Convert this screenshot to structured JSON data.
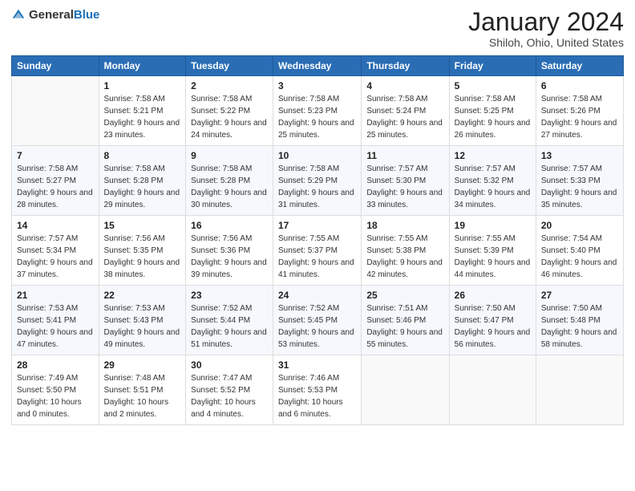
{
  "header": {
    "logo_general": "General",
    "logo_blue": "Blue",
    "title": "January 2024",
    "subtitle": "Shiloh, Ohio, United States"
  },
  "days_of_week": [
    "Sunday",
    "Monday",
    "Tuesday",
    "Wednesday",
    "Thursday",
    "Friday",
    "Saturday"
  ],
  "weeks": [
    [
      {
        "day": "",
        "sunrise": "",
        "sunset": "",
        "daylight": ""
      },
      {
        "day": "1",
        "sunrise": "Sunrise: 7:58 AM",
        "sunset": "Sunset: 5:21 PM",
        "daylight": "Daylight: 9 hours and 23 minutes."
      },
      {
        "day": "2",
        "sunrise": "Sunrise: 7:58 AM",
        "sunset": "Sunset: 5:22 PM",
        "daylight": "Daylight: 9 hours and 24 minutes."
      },
      {
        "day": "3",
        "sunrise": "Sunrise: 7:58 AM",
        "sunset": "Sunset: 5:23 PM",
        "daylight": "Daylight: 9 hours and 25 minutes."
      },
      {
        "day": "4",
        "sunrise": "Sunrise: 7:58 AM",
        "sunset": "Sunset: 5:24 PM",
        "daylight": "Daylight: 9 hours and 25 minutes."
      },
      {
        "day": "5",
        "sunrise": "Sunrise: 7:58 AM",
        "sunset": "Sunset: 5:25 PM",
        "daylight": "Daylight: 9 hours and 26 minutes."
      },
      {
        "day": "6",
        "sunrise": "Sunrise: 7:58 AM",
        "sunset": "Sunset: 5:26 PM",
        "daylight": "Daylight: 9 hours and 27 minutes."
      }
    ],
    [
      {
        "day": "7",
        "sunrise": "Sunrise: 7:58 AM",
        "sunset": "Sunset: 5:27 PM",
        "daylight": "Daylight: 9 hours and 28 minutes."
      },
      {
        "day": "8",
        "sunrise": "Sunrise: 7:58 AM",
        "sunset": "Sunset: 5:28 PM",
        "daylight": "Daylight: 9 hours and 29 minutes."
      },
      {
        "day": "9",
        "sunrise": "Sunrise: 7:58 AM",
        "sunset": "Sunset: 5:28 PM",
        "daylight": "Daylight: 9 hours and 30 minutes."
      },
      {
        "day": "10",
        "sunrise": "Sunrise: 7:58 AM",
        "sunset": "Sunset: 5:29 PM",
        "daylight": "Daylight: 9 hours and 31 minutes."
      },
      {
        "day": "11",
        "sunrise": "Sunrise: 7:57 AM",
        "sunset": "Sunset: 5:30 PM",
        "daylight": "Daylight: 9 hours and 33 minutes."
      },
      {
        "day": "12",
        "sunrise": "Sunrise: 7:57 AM",
        "sunset": "Sunset: 5:32 PM",
        "daylight": "Daylight: 9 hours and 34 minutes."
      },
      {
        "day": "13",
        "sunrise": "Sunrise: 7:57 AM",
        "sunset": "Sunset: 5:33 PM",
        "daylight": "Daylight: 9 hours and 35 minutes."
      }
    ],
    [
      {
        "day": "14",
        "sunrise": "Sunrise: 7:57 AM",
        "sunset": "Sunset: 5:34 PM",
        "daylight": "Daylight: 9 hours and 37 minutes."
      },
      {
        "day": "15",
        "sunrise": "Sunrise: 7:56 AM",
        "sunset": "Sunset: 5:35 PM",
        "daylight": "Daylight: 9 hours and 38 minutes."
      },
      {
        "day": "16",
        "sunrise": "Sunrise: 7:56 AM",
        "sunset": "Sunset: 5:36 PM",
        "daylight": "Daylight: 9 hours and 39 minutes."
      },
      {
        "day": "17",
        "sunrise": "Sunrise: 7:55 AM",
        "sunset": "Sunset: 5:37 PM",
        "daylight": "Daylight: 9 hours and 41 minutes."
      },
      {
        "day": "18",
        "sunrise": "Sunrise: 7:55 AM",
        "sunset": "Sunset: 5:38 PM",
        "daylight": "Daylight: 9 hours and 42 minutes."
      },
      {
        "day": "19",
        "sunrise": "Sunrise: 7:55 AM",
        "sunset": "Sunset: 5:39 PM",
        "daylight": "Daylight: 9 hours and 44 minutes."
      },
      {
        "day": "20",
        "sunrise": "Sunrise: 7:54 AM",
        "sunset": "Sunset: 5:40 PM",
        "daylight": "Daylight: 9 hours and 46 minutes."
      }
    ],
    [
      {
        "day": "21",
        "sunrise": "Sunrise: 7:53 AM",
        "sunset": "Sunset: 5:41 PM",
        "daylight": "Daylight: 9 hours and 47 minutes."
      },
      {
        "day": "22",
        "sunrise": "Sunrise: 7:53 AM",
        "sunset": "Sunset: 5:43 PM",
        "daylight": "Daylight: 9 hours and 49 minutes."
      },
      {
        "day": "23",
        "sunrise": "Sunrise: 7:52 AM",
        "sunset": "Sunset: 5:44 PM",
        "daylight": "Daylight: 9 hours and 51 minutes."
      },
      {
        "day": "24",
        "sunrise": "Sunrise: 7:52 AM",
        "sunset": "Sunset: 5:45 PM",
        "daylight": "Daylight: 9 hours and 53 minutes."
      },
      {
        "day": "25",
        "sunrise": "Sunrise: 7:51 AM",
        "sunset": "Sunset: 5:46 PM",
        "daylight": "Daylight: 9 hours and 55 minutes."
      },
      {
        "day": "26",
        "sunrise": "Sunrise: 7:50 AM",
        "sunset": "Sunset: 5:47 PM",
        "daylight": "Daylight: 9 hours and 56 minutes."
      },
      {
        "day": "27",
        "sunrise": "Sunrise: 7:50 AM",
        "sunset": "Sunset: 5:48 PM",
        "daylight": "Daylight: 9 hours and 58 minutes."
      }
    ],
    [
      {
        "day": "28",
        "sunrise": "Sunrise: 7:49 AM",
        "sunset": "Sunset: 5:50 PM",
        "daylight": "Daylight: 10 hours and 0 minutes."
      },
      {
        "day": "29",
        "sunrise": "Sunrise: 7:48 AM",
        "sunset": "Sunset: 5:51 PM",
        "daylight": "Daylight: 10 hours and 2 minutes."
      },
      {
        "day": "30",
        "sunrise": "Sunrise: 7:47 AM",
        "sunset": "Sunset: 5:52 PM",
        "daylight": "Daylight: 10 hours and 4 minutes."
      },
      {
        "day": "31",
        "sunrise": "Sunrise: 7:46 AM",
        "sunset": "Sunset: 5:53 PM",
        "daylight": "Daylight: 10 hours and 6 minutes."
      },
      {
        "day": "",
        "sunrise": "",
        "sunset": "",
        "daylight": ""
      },
      {
        "day": "",
        "sunrise": "",
        "sunset": "",
        "daylight": ""
      },
      {
        "day": "",
        "sunrise": "",
        "sunset": "",
        "daylight": ""
      }
    ]
  ]
}
